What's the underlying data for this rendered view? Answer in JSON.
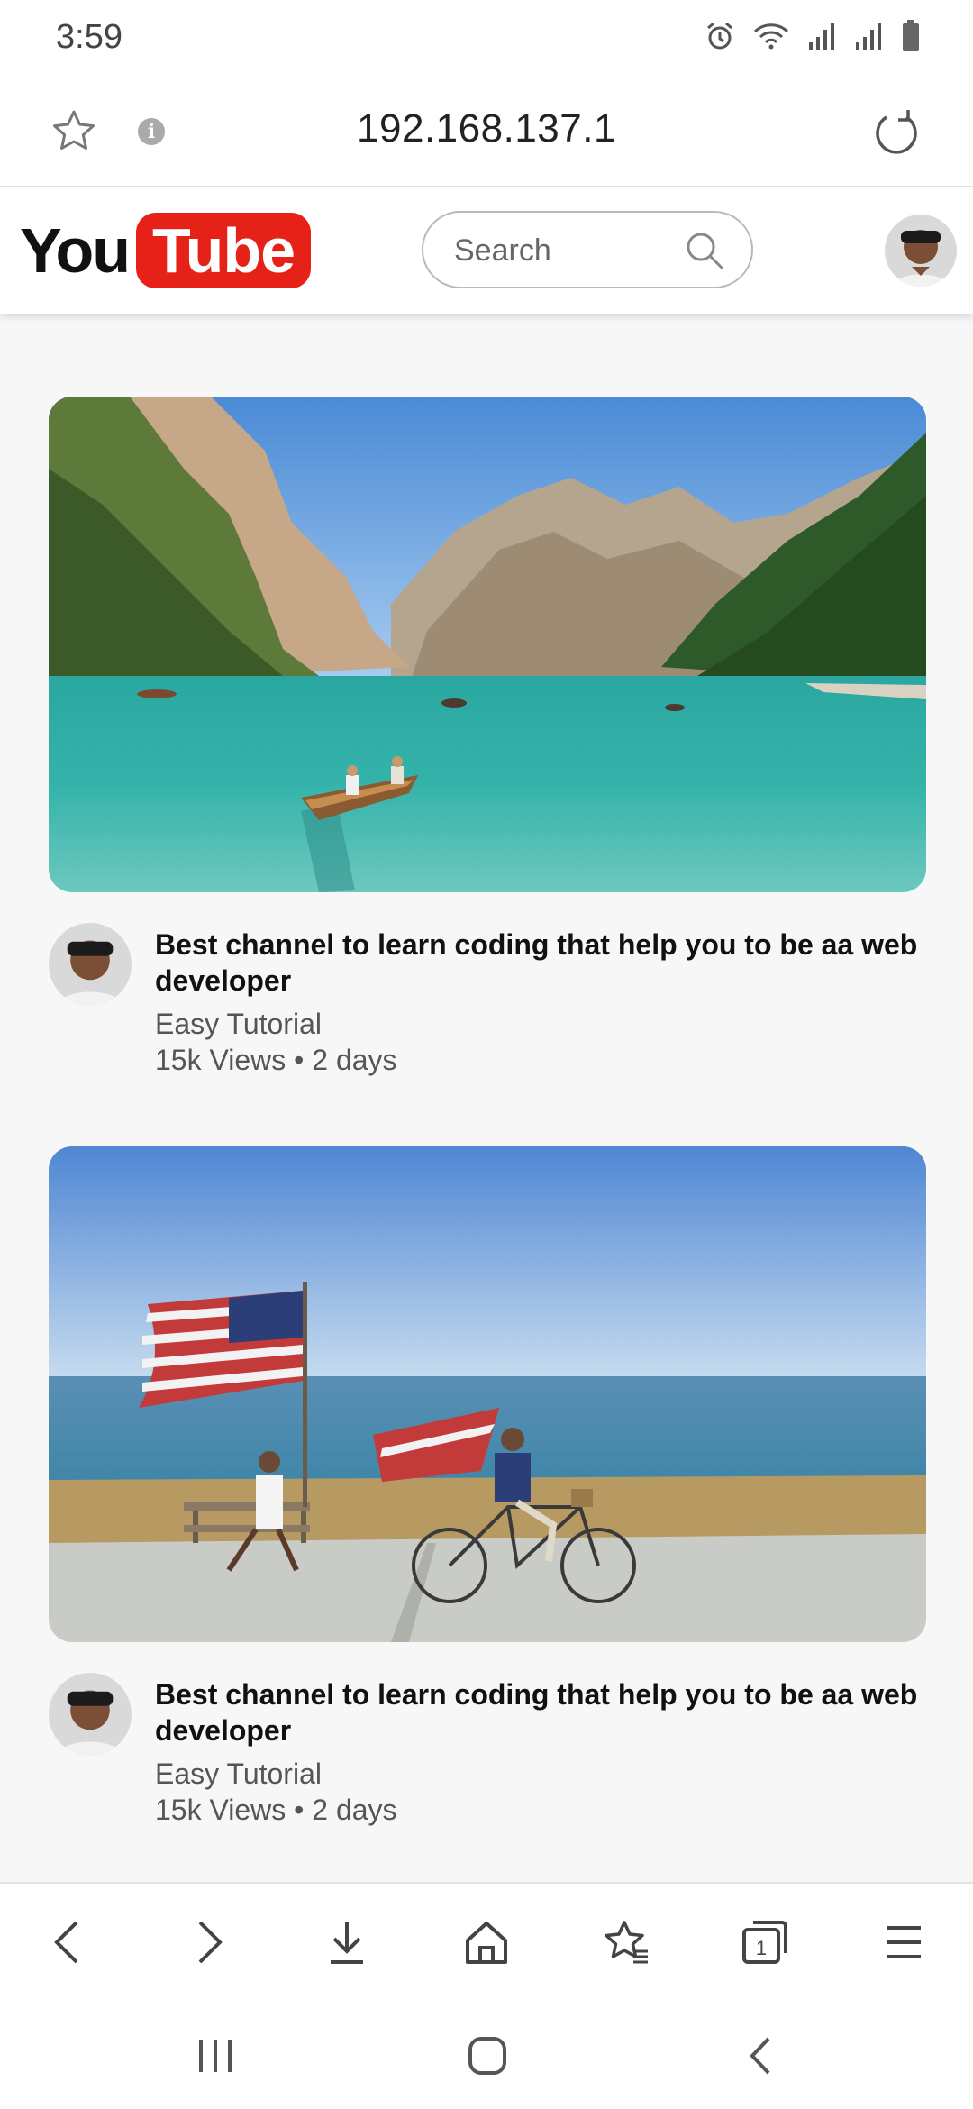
{
  "status_bar": {
    "time": "3:59",
    "icons": [
      "alarm-icon",
      "wifi-icon",
      "signal-icon",
      "signal-icon",
      "battery-icon"
    ]
  },
  "browser": {
    "url": "192.168.137.1",
    "icons": [
      "star-icon",
      "info-icon",
      "reload-icon"
    ]
  },
  "header": {
    "logo_you": "You",
    "logo_tube": "Tube",
    "search_placeholder": "Search",
    "brand_color": "#e62117"
  },
  "videos": [
    {
      "title": "Best channel to learn coding that help you to be aa web developer",
      "channel": "Easy Tutorial",
      "stats": "15k Views • 2 days",
      "thumbnail": "lake-mountains-thumbnail"
    },
    {
      "title": "Best channel to learn coding that help you to be aa web developer",
      "channel": "Easy Tutorial",
      "stats": "15k Views • 2 days",
      "thumbnail": "flag-beach-thumbnail"
    }
  ],
  "bottom_nav": {
    "icons": [
      "back-icon",
      "forward-icon",
      "download-icon",
      "home-icon",
      "bookmarks-icon",
      "tabs-icon",
      "menu-icon"
    ],
    "tab_count": "1"
  },
  "system_nav": {
    "icons": [
      "recents-icon",
      "home-icon",
      "back-icon"
    ]
  }
}
